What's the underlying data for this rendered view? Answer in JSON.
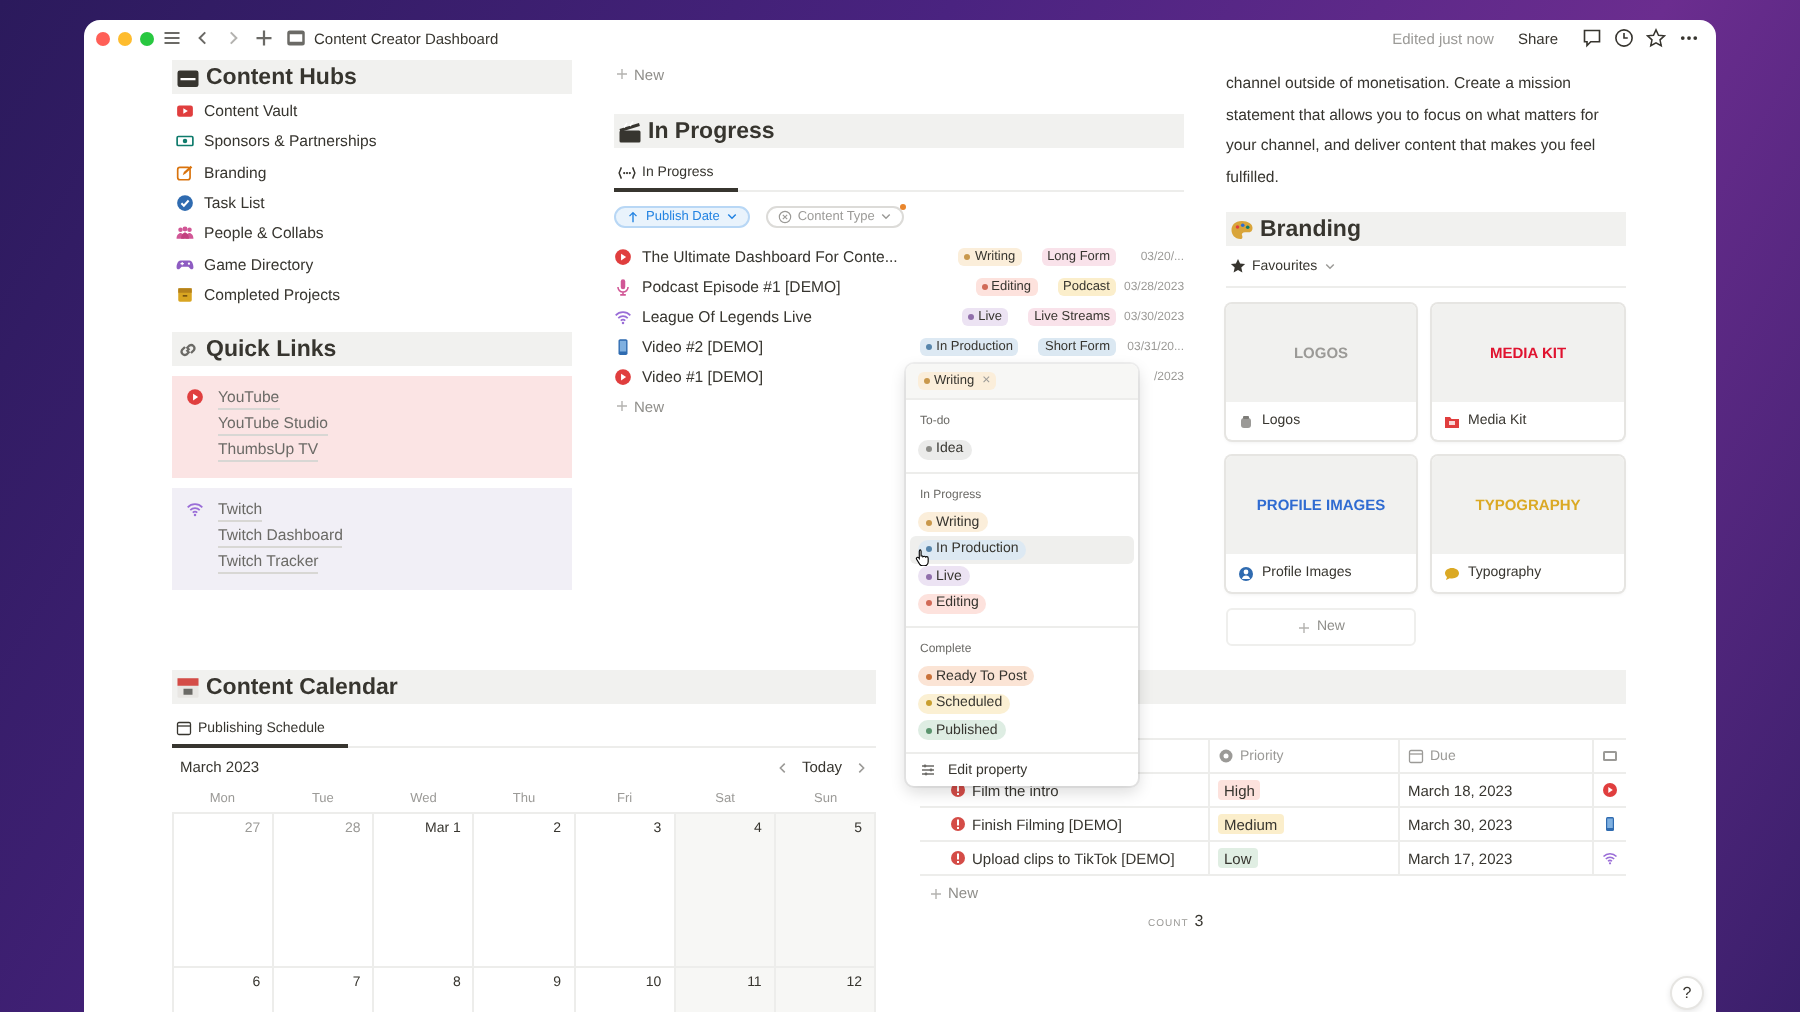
{
  "window": {
    "title": "Content Creator Dashboard",
    "status": "Edited just now",
    "share": "Share"
  },
  "content_hubs": {
    "title": "Content Hubs",
    "items": [
      {
        "label": "Content Vault",
        "kind": "video"
      },
      {
        "label": "Sponsors & Partnerships",
        "kind": "banknote"
      },
      {
        "label": "Branding",
        "kind": "pencil"
      },
      {
        "label": "Task List",
        "kind": "check"
      },
      {
        "label": "People & Collabs",
        "kind": "people"
      },
      {
        "label": "Game Directory",
        "kind": "gamepad"
      },
      {
        "label": "Completed Projects",
        "kind": "box"
      }
    ]
  },
  "quick_links": {
    "title": "Quick Links",
    "groups": [
      {
        "kind": "play",
        "color": "#fbe4e4",
        "links": [
          "YouTube",
          "YouTube Studio",
          "ThumbsUp TV"
        ]
      },
      {
        "kind": "wifi",
        "color": "#f1eff6",
        "links": [
          "Twitch",
          "Twitch Dashboard",
          "Twitch Tracker"
        ]
      }
    ]
  },
  "in_progress": {
    "new_above": "New",
    "title": "In Progress",
    "tab": {
      "label": "In Progress",
      "selected": true
    },
    "filters": [
      {
        "label": "Publish Date",
        "active": true
      },
      {
        "label": "Content Type",
        "active": false
      }
    ],
    "rows": [
      {
        "kind": "play",
        "title": "The Ultimate Dashboard For Conte...",
        "status": {
          "label": "Writing",
          "color": "#fbeeda"
        },
        "type": {
          "label": "Long Form",
          "color": "#f9e2ea"
        },
        "date": "03/20/..."
      },
      {
        "kind": "mic",
        "title": "Podcast Episode #1 [DEMO]",
        "status": {
          "label": "Editing",
          "color": "#fde2dd"
        },
        "type": {
          "label": "Podcast",
          "color": "#fbeecb"
        },
        "date": "03/28/2023"
      },
      {
        "kind": "wifi",
        "title": "League Of Legends Live",
        "status": {
          "label": "Live",
          "color": "#ece3f3"
        },
        "type": {
          "label": "Live Streams",
          "color": "#f9e2ea"
        },
        "date": "03/30/2023"
      },
      {
        "kind": "phone",
        "title": "Video #2 [DEMO]",
        "status": {
          "label": "In Production",
          "color": "#dde9f3"
        },
        "type": {
          "label": "Short Form",
          "color": "#dbe8f2"
        },
        "date": "03/31/20..."
      },
      {
        "kind": "play",
        "title": "Video #1 [DEMO]",
        "date": "/2023"
      }
    ],
    "new": "New"
  },
  "dropdown": {
    "current": {
      "label": "Writing",
      "color": "#fbeeda",
      "remove": "×"
    },
    "groups": [
      {
        "title": "To-do",
        "options": [
          {
            "label": "Idea",
            "color": "#ebebea",
            "hovered": false
          }
        ]
      },
      {
        "title": "In Progress",
        "options": [
          {
            "label": "Writing",
            "color": "#fbeeda",
            "hovered": false
          },
          {
            "label": "In Production",
            "color": "#dde9f3",
            "hovered": true
          },
          {
            "label": "Live",
            "color": "#ece3f3",
            "hovered": false
          },
          {
            "label": "Editing",
            "color": "#fde2dd",
            "hovered": false
          }
        ]
      },
      {
        "title": "Complete",
        "options": [
          {
            "label": "Ready To Post",
            "color": "#fbe4d5",
            "hovered": false
          },
          {
            "label": "Scheduled",
            "color": "#fbf0d3",
            "hovered": false
          },
          {
            "label": "Published",
            "color": "#deede3",
            "hovered": false
          }
        ]
      }
    ],
    "action": "Edit property"
  },
  "mission": {
    "text": "channel outside of monetisation. Create a mission statement that allows you to focus on what matters for your channel, and deliver content that makes you feel fulfilled."
  },
  "branding": {
    "title": "Branding",
    "view": "Favourites",
    "cards": [
      {
        "cover": "LOGOS",
        "color": "#9b9a97",
        "name": "Logos",
        "kind": "jar"
      },
      {
        "cover": "MEDIA KIT",
        "color": "#e0132f",
        "name": "Media Kit",
        "kind": "folder"
      },
      {
        "cover": "PROFILE IMAGES",
        "color": "#2f6bd1",
        "name": "Profile Images",
        "kind": "person"
      },
      {
        "cover": "TYPOGRAPHY",
        "color": "#dba924",
        "name": "Typography",
        "kind": "bubble"
      }
    ],
    "new": "New"
  },
  "calendar": {
    "title": "Content Calendar",
    "tab": {
      "label": "Publishing Schedule",
      "selected": true
    },
    "month": "March 2023",
    "today": "Today",
    "weekdays": [
      "Mon",
      "Tue",
      "Wed",
      "Thu",
      "Fri",
      "Sat",
      "Sun"
    ],
    "weeks": [
      [
        {
          "label": "27",
          "muted": true
        },
        {
          "label": "28",
          "muted": true
        },
        {
          "label": "Mar 1",
          "muted": false
        },
        {
          "label": "2",
          "muted": false
        },
        {
          "label": "3",
          "muted": false
        },
        {
          "label": "4",
          "muted": false
        },
        {
          "label": "5",
          "muted": false
        }
      ],
      [
        {
          "label": "6",
          "muted": false
        },
        {
          "label": "7",
          "muted": false
        },
        {
          "label": "8",
          "muted": false
        },
        {
          "label": "9",
          "muted": false
        },
        {
          "label": "10",
          "muted": false
        },
        {
          "label": "11",
          "muted": false
        },
        {
          "label": "12",
          "muted": false
        }
      ]
    ]
  },
  "tasks": {
    "columns": [
      {
        "label": "Priority",
        "kind": "circle"
      },
      {
        "label": "Due",
        "kind": "calendar"
      },
      {
        "kind": "tv"
      }
    ],
    "rows": [
      {
        "title": "Film the intro",
        "priority": {
          "label": "High",
          "color": "#fde2dd"
        },
        "due": "March 18, 2023",
        "kind": "play"
      },
      {
        "title": "Finish Filming [DEMO]",
        "priority": {
          "label": "Medium",
          "color": "#fbeecb"
        },
        "due": "March 30, 2023",
        "kind": "phone"
      },
      {
        "title": "Upload clips to TikTok [DEMO]",
        "priority": {
          "label": "Low",
          "color": "#e0eee3"
        },
        "due": "March 17, 2023",
        "kind": "wifi"
      }
    ],
    "new": "New",
    "count_label": "COUNT",
    "count": "3"
  },
  "help": "?"
}
